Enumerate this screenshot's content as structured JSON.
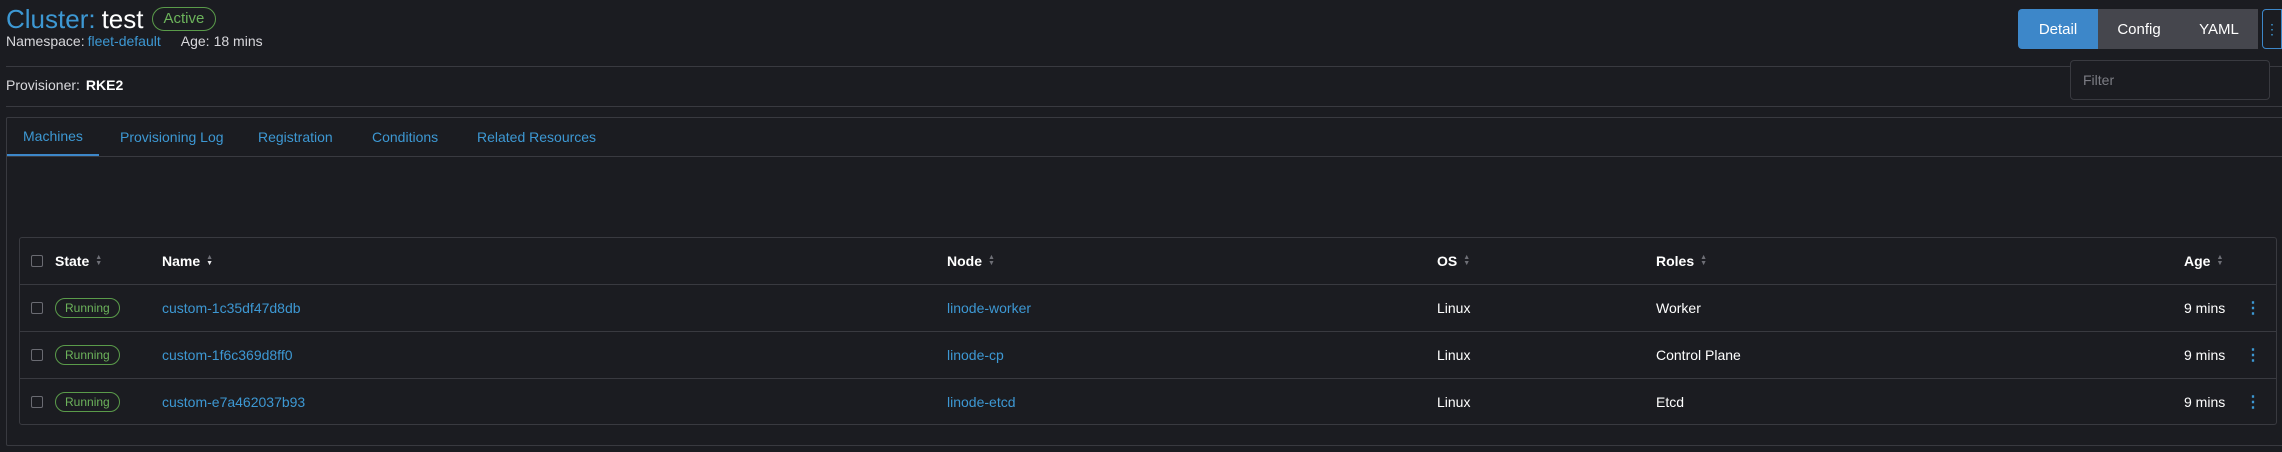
{
  "header": {
    "title_prefix": "Cluster:",
    "title_name": "test",
    "status": "Active",
    "namespace_label": "Namespace:",
    "namespace_value": "fleet-default",
    "age_label": "Age:",
    "age_value": "18 mins"
  },
  "view_switch": {
    "detail": "Detail",
    "config": "Config",
    "yaml": "YAML",
    "more": "⋮"
  },
  "provisioner": {
    "label": "Provisioner:",
    "value": "RKE2"
  },
  "tabs": [
    "Machines",
    "Provisioning Log",
    "Registration",
    "Conditions",
    "Related Resources"
  ],
  "filter": {
    "placeholder": "Filter",
    "value": ""
  },
  "table": {
    "headers": {
      "state": "State",
      "name": "Name",
      "node": "Node",
      "os": "OS",
      "roles": "Roles",
      "age": "Age"
    },
    "rows": [
      {
        "state": "Running",
        "name": "custom-1c35df47d8db",
        "node": "linode-worker",
        "os": "Linux",
        "roles": "Worker",
        "age": "9 mins"
      },
      {
        "state": "Running",
        "name": "custom-1f6c369d8ff0",
        "node": "linode-cp",
        "os": "Linux",
        "roles": "Control Plane",
        "age": "9 mins"
      },
      {
        "state": "Running",
        "name": "custom-e7a462037b93",
        "node": "linode-etcd",
        "os": "Linux",
        "roles": "Etcd",
        "age": "9 mins"
      }
    ]
  },
  "icons": {
    "sort": "sort-arrows-icon",
    "row_menu": "kebab-menu-icon"
  },
  "colors": {
    "accent": "#3d87c9",
    "link": "#3d98d3",
    "success": "#6cb35b",
    "background": "#1b1c21"
  }
}
